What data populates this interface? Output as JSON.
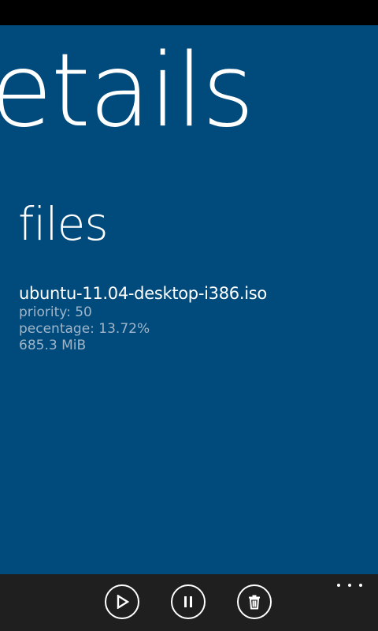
{
  "colors": {
    "accent_background": "#004a7c",
    "app_bar_background": "#1f1f1f",
    "primary_text": "#ffffff",
    "secondary_text": "#9fb5c9"
  },
  "header": {
    "title": "etails"
  },
  "section": {
    "title": "files"
  },
  "files": [
    {
      "name": "ubuntu-11.04-desktop-i386.iso",
      "priority": "priority: 50",
      "percentage": "pecentage: 13.72%",
      "size": "685.3 MiB"
    }
  ],
  "app_bar": {
    "buttons": [
      {
        "icon": "play-icon"
      },
      {
        "icon": "pause-icon"
      },
      {
        "icon": "trash-icon"
      }
    ],
    "more_icon": "ellipsis-icon"
  }
}
